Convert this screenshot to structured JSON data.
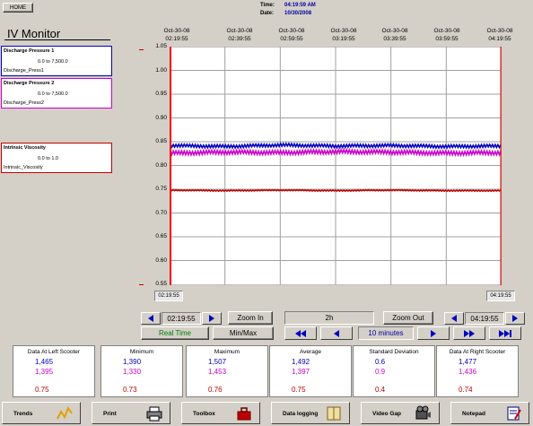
{
  "header": {
    "home_label": "HOME",
    "time_label": "Time:",
    "time_value": "04:19:59 AM",
    "date_label": "Date:",
    "date_value": "10/30/2008"
  },
  "title": "IV Monitor",
  "legends": [
    {
      "name": "Discharge Pressure 1",
      "min": "0.0",
      "to": "to",
      "max": "7,500.0",
      "tag": "Discharge_Press1",
      "color": "#0000c0"
    },
    {
      "name": "Discharge Pressure 2",
      "min": "0.0",
      "to": "to",
      "max": "7,500.0",
      "tag": "Discharge_Press2",
      "color": "#cc00cc"
    },
    {
      "name": "Intrinsic Viscosity",
      "min": "0.0",
      "to": "to",
      "max": "1.0",
      "tag": "Intrinsic_Viscosity",
      "color": "#c00000"
    }
  ],
  "chart": {
    "timestamps": [
      {
        "date": "Oct-30-08",
        "time": "02:19:55"
      },
      {
        "date": "Oct-30-08",
        "time": "02:39:55"
      },
      {
        "date": "Oct-30-08",
        "time": "02:59:55"
      },
      {
        "date": "Oct-30-08",
        "time": "03:19:55"
      },
      {
        "date": "Oct-30-08",
        "time": "03:39:55"
      },
      {
        "date": "Oct-30-08",
        "time": "03:59:55"
      },
      {
        "date": "Oct-30-08",
        "time": "04:19:55"
      }
    ],
    "y_ticks": [
      "1.05",
      "1.00",
      "0.95",
      "0.90",
      "0.85",
      "0.80",
      "0.75",
      "0.70",
      "0.65",
      "0.60",
      "0.55"
    ],
    "left_scooter": "02:19:55",
    "right_scooter": "04:19:55"
  },
  "chart_data": {
    "type": "line",
    "x": [
      "02:19:55",
      "02:39:55",
      "02:59:55",
      "03:19:55",
      "03:39:55",
      "03:59:55",
      "04:19:55"
    ],
    "ylim": [
      0.55,
      1.05
    ],
    "series": [
      {
        "values": [
          0.842,
          0.84,
          0.843,
          0.841,
          0.842,
          0.84,
          0.841
        ]
      },
      {
        "values": [
          0.826,
          0.828,
          0.827,
          0.829,
          0.828,
          0.826,
          0.827
        ]
      },
      {
        "values": [
          0.748,
          0.747,
          0.748,
          0.747,
          0.748,
          0.747,
          0.747
        ]
      }
    ],
    "grid": true
  },
  "controls": {
    "left_time": "02:19:55",
    "zoom_in": "Zoom In",
    "span": "2h",
    "zoom_out": "Zoom Out",
    "right_time": "04:19:55",
    "real_time": "Real Time",
    "min_max": "Min/Max",
    "interval": "10 minutes"
  },
  "stats": [
    {
      "header": "Data At Left Scooter",
      "blue": "1,465",
      "pink": "1,395",
      "red": "0.75"
    },
    {
      "header": "Minimum",
      "blue": "1,390",
      "pink": "1,330",
      "red": "0.73"
    },
    {
      "header": "Maximum",
      "blue": "1,507",
      "pink": "1,453",
      "red": "0.76"
    },
    {
      "header": "Average",
      "blue": "1,492",
      "pink": "1,397",
      "red": "0.75"
    },
    {
      "header": "Standard Deviation",
      "blue": "0.6",
      "pink": "0.9",
      "red": "0.4"
    },
    {
      "header": "Data At Right Scooter",
      "blue": "1,477",
      "pink": "1,436",
      "red": "0.74"
    }
  ],
  "bottom_nav": [
    {
      "label": "Trends",
      "icon": "trends-icon"
    },
    {
      "label": "Print",
      "icon": "printer-icon"
    },
    {
      "label": "Toolbox",
      "icon": "toolbox-icon"
    },
    {
      "label": "Data logging",
      "icon": "book-icon"
    },
    {
      "label": "Video Gap",
      "icon": "camera-icon"
    },
    {
      "label": "Notepad",
      "icon": "notepad-icon"
    }
  ]
}
